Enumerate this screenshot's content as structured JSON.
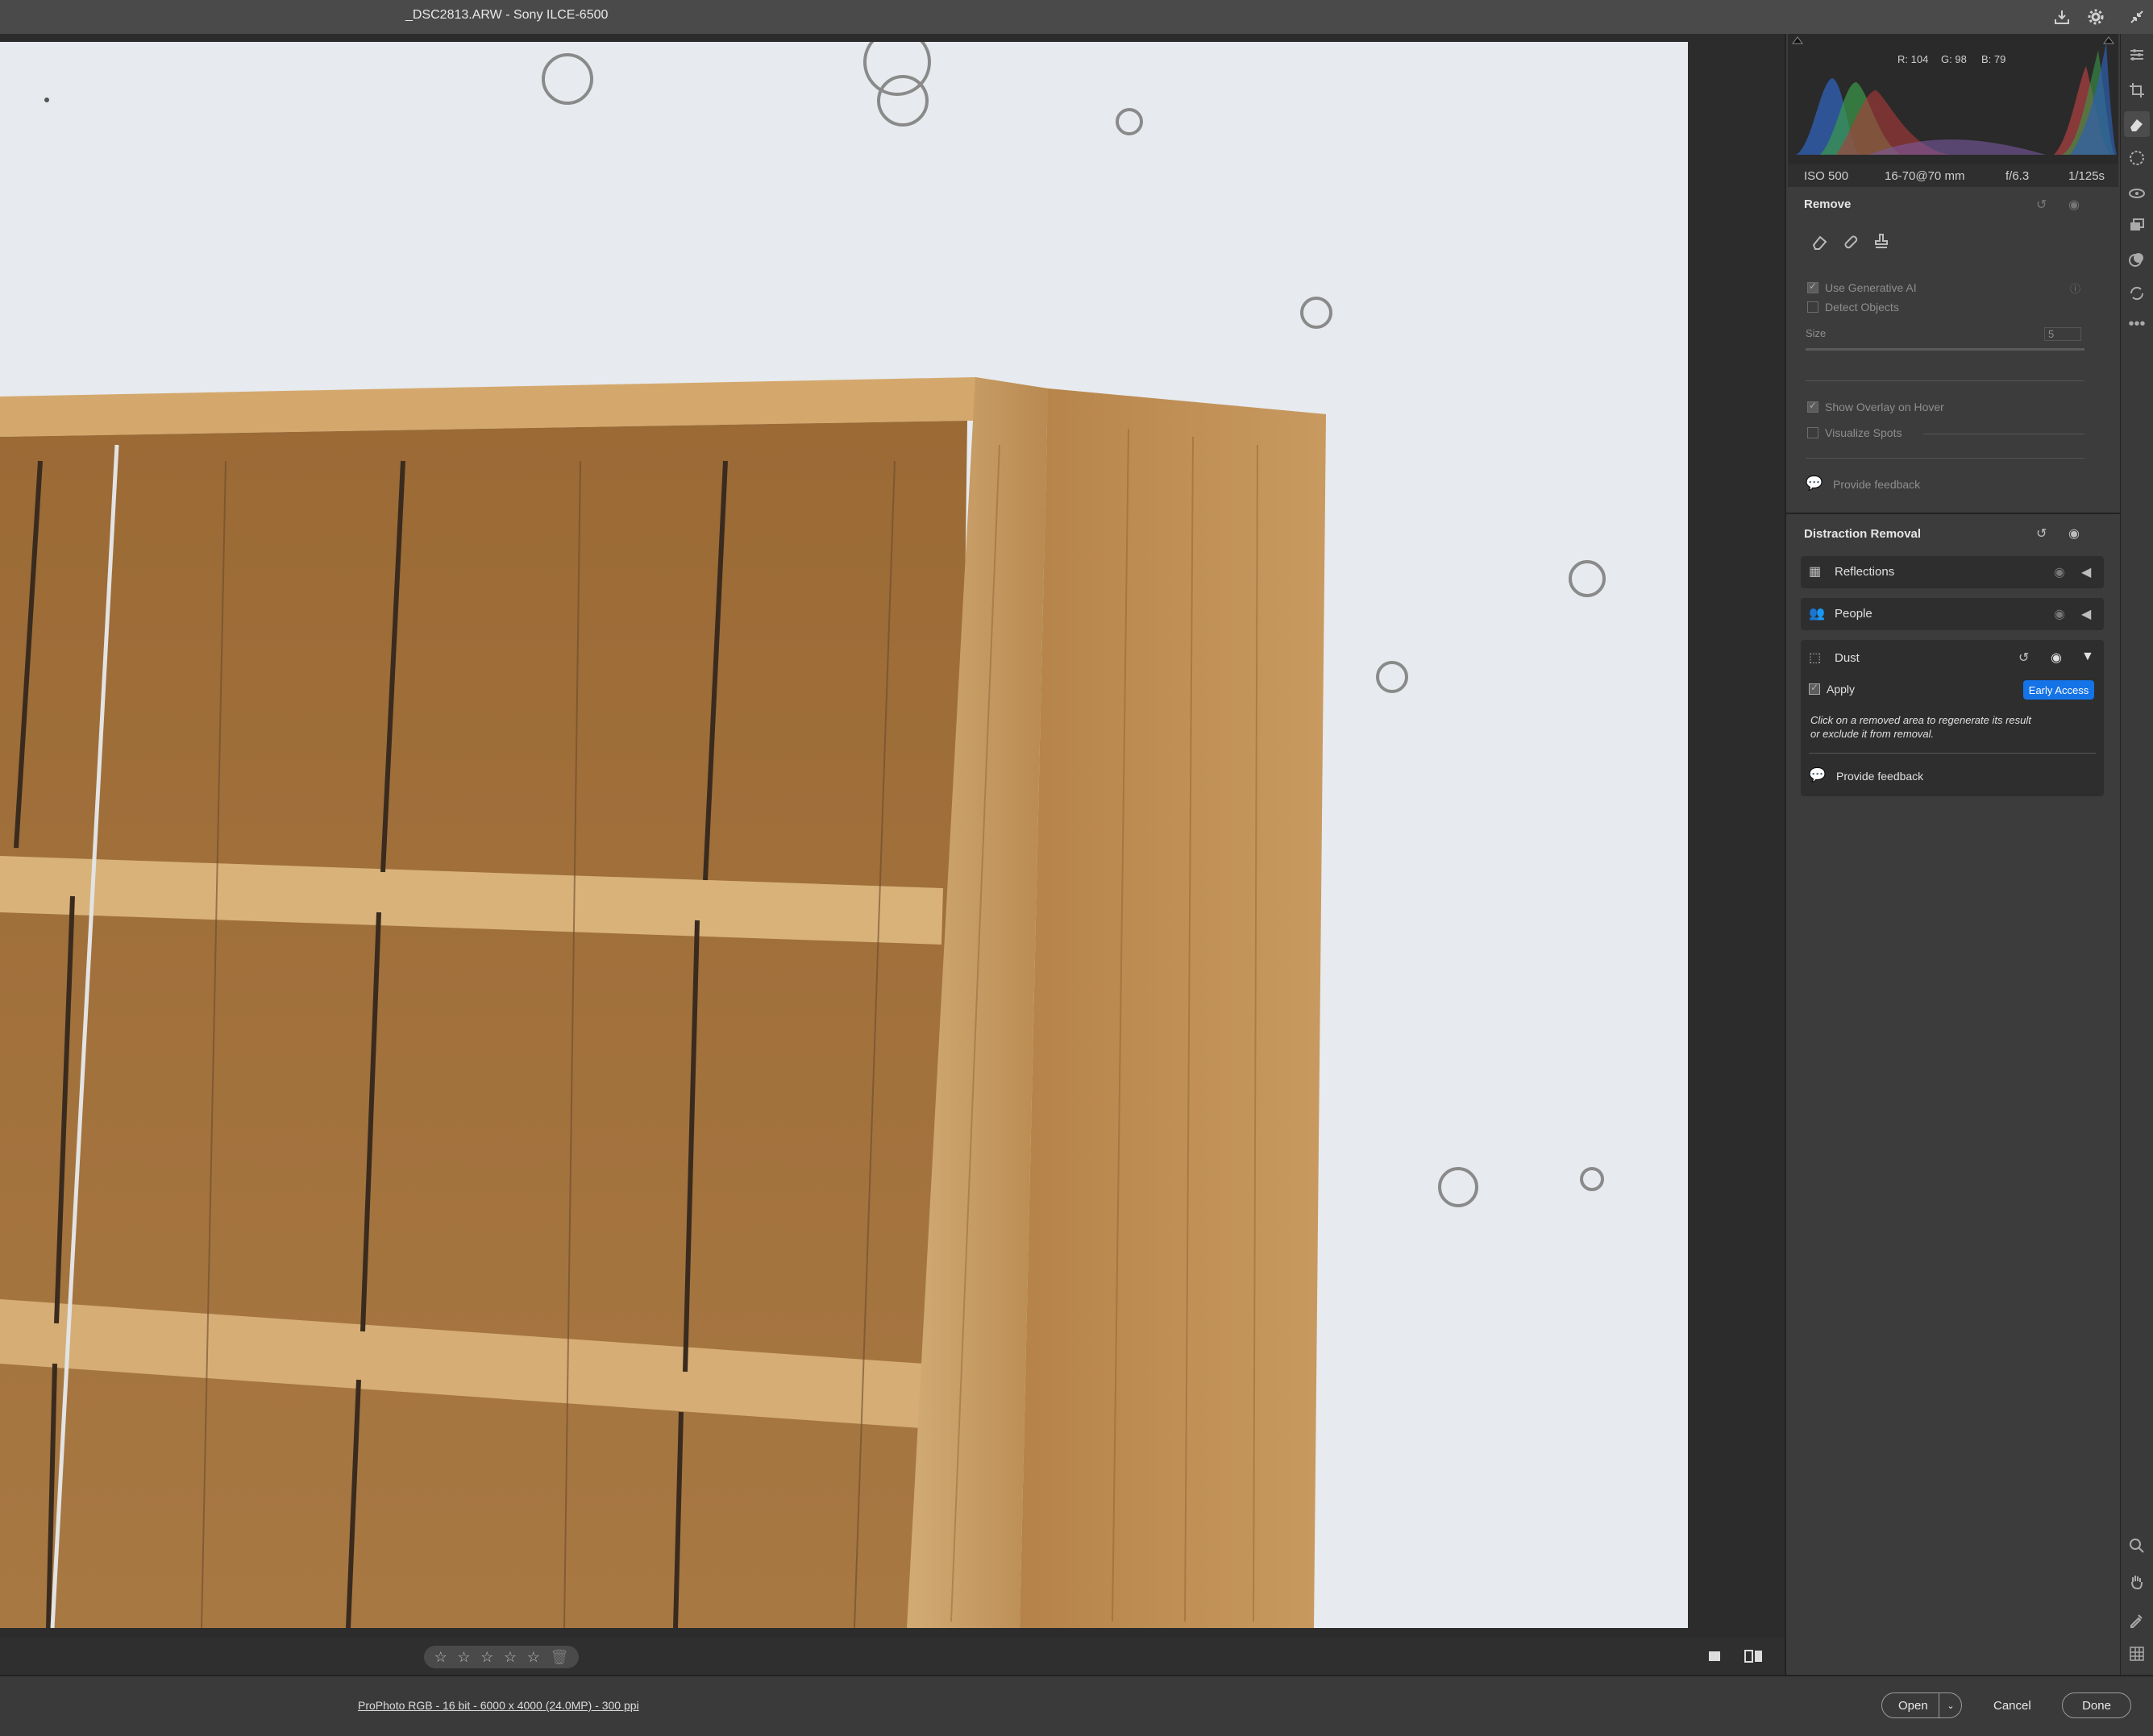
{
  "window": {
    "title": "_DSC2813.ARW  -  Sony ILCE-6500",
    "icons": [
      "save-icon",
      "settings-gear-icon",
      "collapse-icon"
    ]
  },
  "histogram": {
    "readout": {
      "r": "R: 104",
      "g": "G: 98",
      "b": "B: 79"
    },
    "exif": {
      "iso": "ISO 500",
      "lens": "16-70@70 mm",
      "aperture": "f/6.3",
      "shutter": "1/125s"
    }
  },
  "remove_panel": {
    "title": "Remove",
    "tools": [
      "eraser-icon",
      "heal-icon",
      "clone-stamp-icon"
    ],
    "use_generative_ai": {
      "label": "Use Generative AI",
      "checked": true
    },
    "detect_objects": {
      "label": "Detect Objects",
      "checked": false
    },
    "size": {
      "label": "Size",
      "value": "5"
    },
    "show_overlay": {
      "label": "Show Overlay on Hover",
      "checked": true
    },
    "visualize_spots": {
      "label": "Visualize Spots",
      "checked": false
    },
    "feedback": "Provide feedback"
  },
  "distraction_removal": {
    "title": "Distraction Removal",
    "rows": [
      {
        "label": "Reflections",
        "icon": "reflections-icon"
      },
      {
        "label": "People",
        "icon": "people-icon"
      }
    ],
    "dust": {
      "label": "Dust",
      "apply": {
        "label": "Apply",
        "checked": true
      },
      "badge": "Early Access",
      "help_line1": "Click on a removed area to regenerate its result",
      "help_line2": "or exclude it from removal.",
      "feedback": "Provide feedback"
    }
  },
  "rating": {
    "stars": 5,
    "filled": 0
  },
  "status": {
    "info": "ProPhoto RGB - 16 bit - 6000 x 4000 (24.0MP) - 300 ppi",
    "open_label": "Open",
    "cancel_label": "Cancel",
    "done_label": "Done"
  },
  "colors": {
    "accent": "#1473e6",
    "panel": "#3c3c3c",
    "background": "#2a2a2a"
  }
}
